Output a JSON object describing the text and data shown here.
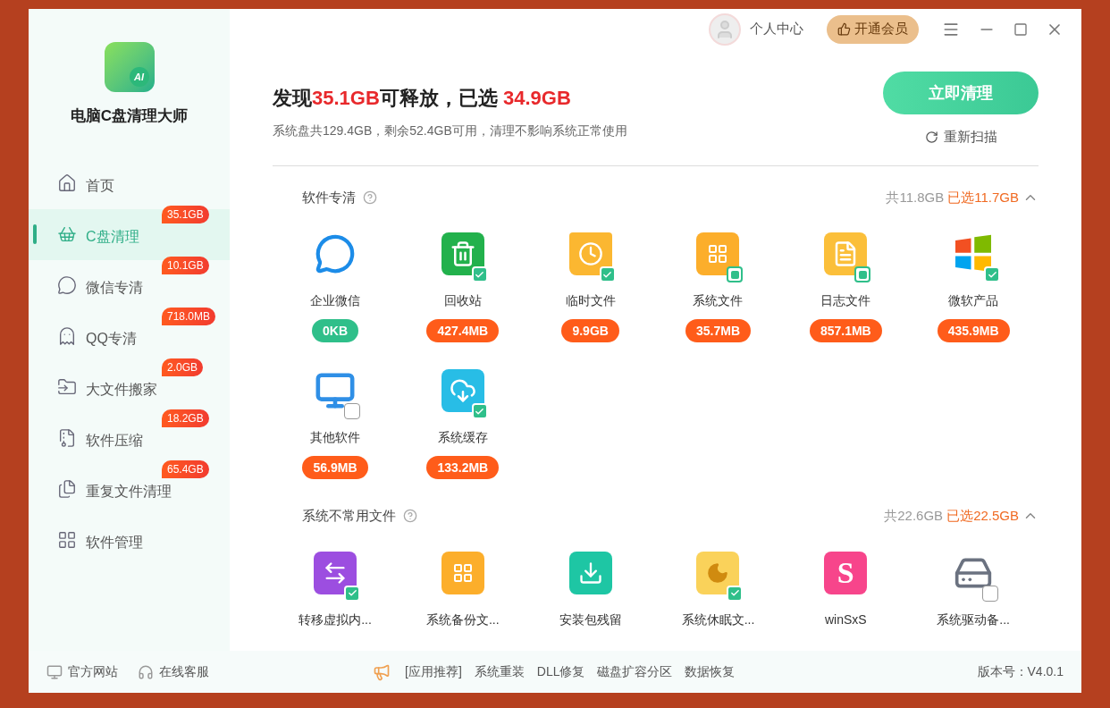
{
  "app": {
    "name": "电脑C盘清理大师",
    "logo_text": "AI"
  },
  "sidebar": {
    "items": [
      {
        "label": "首页",
        "selected": false
      },
      {
        "label": "C盘清理",
        "selected": true,
        "badge": "35.1GB"
      },
      {
        "label": "微信专清",
        "selected": false,
        "badge": "10.1GB"
      },
      {
        "label": "QQ专清",
        "selected": false,
        "badge": "718.0MB"
      },
      {
        "label": "大文件搬家",
        "selected": false,
        "badge": "2.0GB"
      },
      {
        "label": "软件压缩",
        "selected": false,
        "badge": "18.2GB"
      },
      {
        "label": "重复文件清理",
        "selected": false,
        "badge": "65.4GB"
      },
      {
        "label": "软件管理",
        "selected": false
      }
    ]
  },
  "topbar": {
    "user": "个人中心",
    "vip": "开通会员"
  },
  "summary": {
    "headline": "发现**35.1GB**可释放，已选 **34.9GB**",
    "detail": "系统盘共129.4GB，剩余52.4GB可用，清理不影响系统正常使用",
    "clean_button": "立即清理",
    "rescan": "重新扫描"
  },
  "sections": [
    {
      "title": "软件专清",
      "total": "共11.8GB",
      "selected_text": "已选11.7GB",
      "expanded": true,
      "items": [
        {
          "name": "企业微信",
          "size": "0KB",
          "kind": "empty"
        },
        {
          "name": "回收站",
          "checked": true,
          "size": "427.4MB",
          "kind": "found"
        },
        {
          "name": "临时文件",
          "checked": true,
          "size": "9.9GB",
          "kind": "found"
        },
        {
          "name": "系统文件",
          "checked": true,
          "partial": true,
          "size": "35.7MB",
          "kind": "found"
        },
        {
          "name": "日志文件",
          "checked": true,
          "partial": true,
          "size": "857.1MB",
          "kind": "found"
        },
        {
          "name": "微软产品",
          "checked": true,
          "size": "435.9MB",
          "kind": "found"
        },
        {
          "name": "其他软件",
          "checked": false,
          "size": "56.9MB",
          "kind": "found"
        },
        {
          "name": "系统缓存",
          "checked": true,
          "size": "133.2MB",
          "kind": "found"
        }
      ]
    },
    {
      "title": "系统不常用文件",
      "total": "共22.6GB",
      "selected_text": "已选22.5GB",
      "expanded": true,
      "items": [
        {
          "name": "转移虚拟内...",
          "checked": true
        },
        {
          "name": "系统备份文..."
        },
        {
          "name": "安装包残留"
        },
        {
          "name": "系统休眠文...",
          "checked": true
        },
        {
          "name": "winSxS",
          "icon_text": "S"
        },
        {
          "name": "系统驱动备...",
          "checked": false
        }
      ]
    }
  ],
  "footer": {
    "links": [
      "官方网站",
      "在线客服"
    ],
    "recommend": "[应用推荐]",
    "apps": [
      "系统重装",
      "DLL修复",
      "磁盘扩容分区",
      "数据恢复"
    ],
    "version": "版本号：V4.0.1"
  }
}
